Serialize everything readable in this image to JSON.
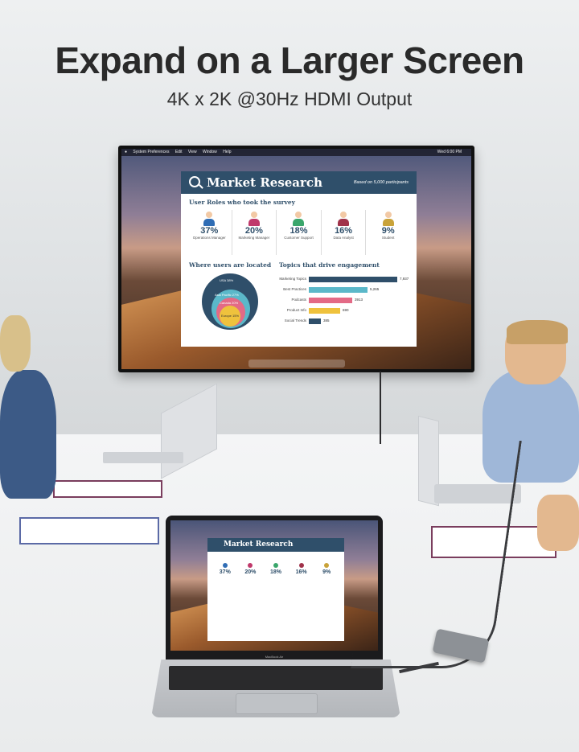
{
  "headline": "Expand on a Larger Screen",
  "subheadline": "4K x 2K @30Hz HDMI Output",
  "screen": {
    "menubar": [
      "System Preferences",
      "Edit",
      "View",
      "Window",
      "Help"
    ],
    "menubar_right": "Wed 6:00 PM",
    "panel": {
      "title": "Market Research",
      "note": "Based on 5,000 participants",
      "roles_heading": "User Roles who took the survey",
      "roles": [
        {
          "pct": "37%",
          "label": "Operations Manager",
          "color": "#2f6db5"
        },
        {
          "pct": "20%",
          "label": "Marketing Manager",
          "color": "#c0396b"
        },
        {
          "pct": "18%",
          "label": "Customer Support",
          "color": "#3aa66b"
        },
        {
          "pct": "16%",
          "label": "Data Analyst",
          "color": "#a0324a"
        },
        {
          "pct": "9%",
          "label": "Student",
          "color": "#c9a33a"
        }
      ],
      "location_heading": "Where users are located",
      "locations": [
        "USA 38%",
        "Asia Pacific 27%",
        "Canada 20%",
        "Europe 15%"
      ],
      "topics_heading": "Topics that drive engagement",
      "topics": [
        {
          "label": "Marketing Topics",
          "value": 7937,
          "display": "7,937",
          "color": "#2f4f6a"
        },
        {
          "label": "Best Practices",
          "value": 5265,
          "display": "5,265",
          "color": "#5bb8c9"
        },
        {
          "label": "Podcasts",
          "value": 3913,
          "display": "3913",
          "color": "#e36a86"
        },
        {
          "label": "Product Info",
          "value": 2850,
          "display": "690",
          "color": "#efc23d"
        },
        {
          "label": "Social Trends",
          "value": 1100,
          "display": "385",
          "color": "#2f4f6a"
        }
      ]
    }
  },
  "laptop_brand": "MacBook Air"
}
